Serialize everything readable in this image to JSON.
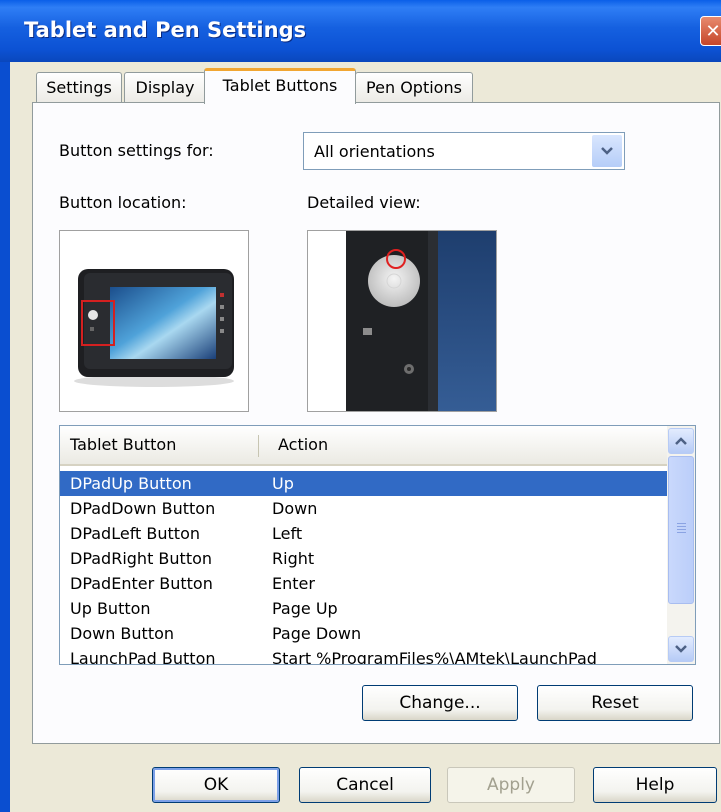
{
  "window": {
    "title": "Tablet and Pen Settings",
    "close_glyph": "✕"
  },
  "tabs": [
    {
      "label": "Settings"
    },
    {
      "label": "Display"
    },
    {
      "label": "Tablet Buttons",
      "active": true
    },
    {
      "label": "Pen Options"
    }
  ],
  "tablet_buttons": {
    "button_settings_label": "Button settings for:",
    "orientation_value": "All orientations",
    "button_location_label": "Button location:",
    "detailed_view_label": "Detailed view:",
    "list": {
      "columns": [
        "Tablet Button",
        "Action"
      ],
      "rows": [
        {
          "button": "DPadUp Button",
          "action": "Up",
          "selected": true
        },
        {
          "button": "DPadDown Button",
          "action": "Down"
        },
        {
          "button": "DPadLeft Button",
          "action": "Left"
        },
        {
          "button": "DPadRight Button",
          "action": "Right"
        },
        {
          "button": "DPadEnter Button",
          "action": "Enter"
        },
        {
          "button": "Up Button",
          "action": "Page Up"
        },
        {
          "button": "Down Button",
          "action": "Page Down"
        },
        {
          "button": "LaunchPad Button",
          "action": "Start %ProgramFiles%\\AMtek\\LaunchPad"
        }
      ]
    },
    "change_button": "Change...",
    "reset_button": "Reset"
  },
  "dialog_buttons": {
    "ok": "OK",
    "cancel": "Cancel",
    "apply": "Apply",
    "help": "Help"
  },
  "icons": {
    "combo_arrow": "chevron-down-icon",
    "scroll_up": "chevron-up-icon",
    "scroll_down": "chevron-down-icon"
  },
  "colors": {
    "titlebar": "#0C52D4",
    "selection": "#316AC5",
    "dialog_bg": "#ECE9D8",
    "active_tab_accent": "#F1A632"
  }
}
